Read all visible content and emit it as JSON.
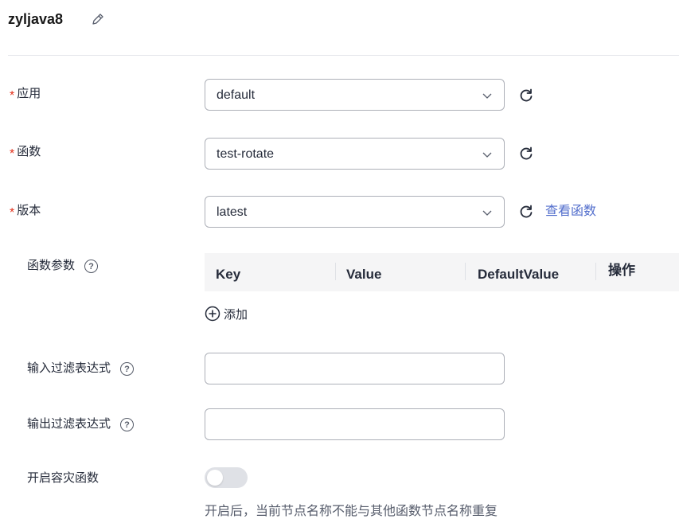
{
  "header": {
    "title": "zyljava8"
  },
  "form": {
    "app": {
      "label": "应用",
      "required_mark": "*",
      "value": "default"
    },
    "function": {
      "label": "函数",
      "required_mark": "*",
      "value": "test-rotate"
    },
    "version": {
      "label": "版本",
      "required_mark": "*",
      "value": "latest",
      "view_link": "查看函数"
    },
    "params": {
      "label": "函数参数",
      "help": "?",
      "columns": [
        "Key",
        "Value",
        "DefaultValue",
        "操作"
      ],
      "add_label": "添加"
    },
    "input_filter": {
      "label": "输入过滤表达式",
      "help": "?",
      "value": ""
    },
    "output_filter": {
      "label": "输出过滤表达式",
      "help": "?",
      "value": ""
    },
    "disaster_recovery": {
      "label": "开启容灾函数",
      "enabled": false,
      "hint": "开启后，当前节点名称不能与其他函数节点名称重复"
    }
  },
  "icons": {
    "edit": "edit-pencil-icon",
    "chevron": "chevron-down-icon",
    "refresh": "refresh-icon",
    "help": "question-circle-icon",
    "add": "plus-circle-icon"
  },
  "colors": {
    "required": "#e3311b",
    "link": "#526ecc",
    "border": "#adb0b8",
    "table_header_bg": "#f5f5f6",
    "toggle_off": "#dfe1e6"
  }
}
